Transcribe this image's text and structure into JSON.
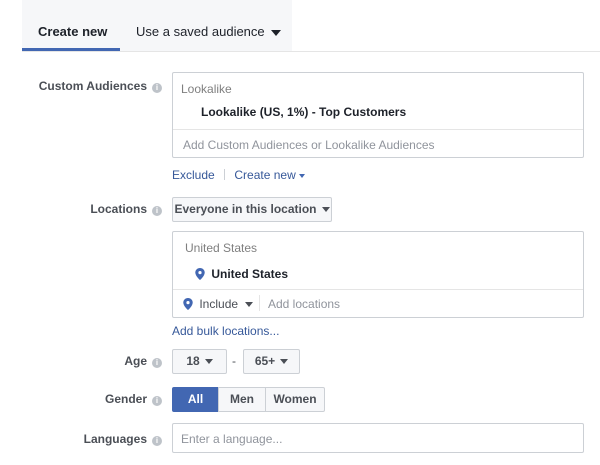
{
  "tabs": {
    "create_new": "Create new",
    "saved_audience": "Use a saved audience"
  },
  "custom_audiences": {
    "label": "Custom Audiences",
    "group_header": "Lookalike",
    "selected": "Lookalike (US, 1%) - Top Customers",
    "placeholder": "Add Custom Audiences or Lookalike Audiences",
    "exclude": "Exclude",
    "create_new": "Create new"
  },
  "locations": {
    "label": "Locations",
    "dropdown": "Everyone in this location",
    "group_header": "United States",
    "selected": "United States",
    "include": "Include",
    "placeholder": "Add locations",
    "bulk_link": "Add bulk locations..."
  },
  "age": {
    "label": "Age",
    "min": "18",
    "separator": "-",
    "max": "65+"
  },
  "gender": {
    "label": "Gender",
    "options": [
      "All",
      "Men",
      "Women"
    ],
    "selected": "All"
  },
  "languages": {
    "label": "Languages",
    "placeholder": "Enter a language..."
  },
  "colors": {
    "accent": "#4267b2",
    "link": "#365899",
    "border": "#ccd0d5"
  }
}
